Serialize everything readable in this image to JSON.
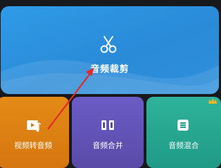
{
  "hero": {
    "title": "音频裁剪",
    "icon": "scissors-icon"
  },
  "tiles": [
    {
      "label": "视频转音频",
      "icon": "video-music-icon",
      "color": "#df8314"
    },
    {
      "label": "音频合并",
      "icon": "merge-icon",
      "color": "#6353b7"
    },
    {
      "label": "音频混合",
      "icon": "mix-icon",
      "color": "#27a891"
    }
  ],
  "badge": {
    "icon": "crown-icon",
    "color": "#f2b324"
  },
  "annotation": {
    "icon": "red-arrow-icon",
    "color": "#e02a2a"
  }
}
